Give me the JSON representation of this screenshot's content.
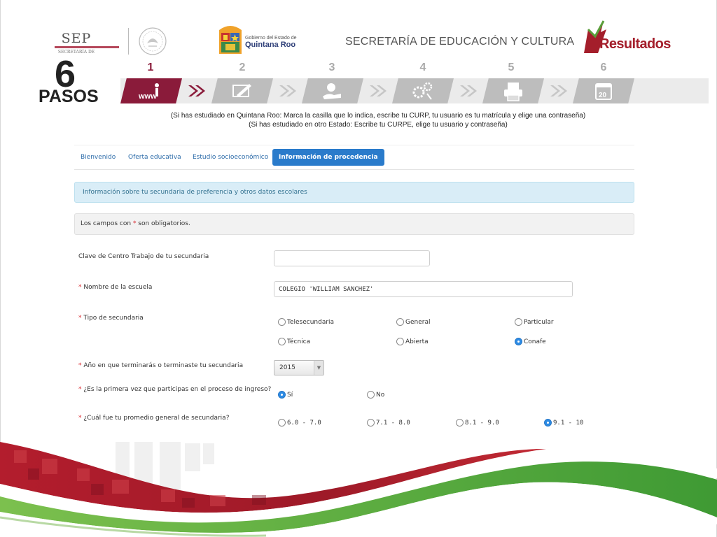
{
  "header": {
    "sep_logo_text": "SEP",
    "sep_logo_sub": "SECRETARÍA DE",
    "qroo_small": "Gobierno del Estado de",
    "qroo_big": "Quintana Roo",
    "title": "SECRETARÍA DE EDUCACIÓN Y CULTURA",
    "results_logo": "Resultados"
  },
  "steps": {
    "big_number": "6",
    "big_word": "PASOS",
    "items": [
      {
        "num": "1",
        "icon": "www-person-icon",
        "active": true
      },
      {
        "num": "2",
        "icon": "form-pencil-icon",
        "active": false
      },
      {
        "num": "3",
        "icon": "money-hand-icon",
        "active": false
      },
      {
        "num": "4",
        "icon": "gears-icon",
        "active": false
      },
      {
        "num": "5",
        "icon": "printer-icon",
        "active": false
      },
      {
        "num": "6",
        "icon": "calendar-icon",
        "active": false
      }
    ],
    "step1_icon_text": "www",
    "step6_icon_text": "20"
  },
  "instructions": {
    "line1": "(Si has estudiado en Quintana Roo: Marca la casilla que lo indica, escribe tu CURP,  tu usuario es tu matrícula y elige una contraseña)",
    "line2": "(Si has estudiado en otro Estado: Escribe tu CURPE, elige tu usuario y contraseña)"
  },
  "tabs": [
    {
      "label": "Bienvenido",
      "active": false
    },
    {
      "label": "Oferta educativa",
      "active": false
    },
    {
      "label": "Estudio socioeconómico",
      "active": false
    },
    {
      "label": "Información de procedencia",
      "active": true
    }
  ],
  "info_message": "Información sobre tu secundaria de preferencia y otros datos escolares",
  "required_note": {
    "before": "Los campos con ",
    "star": "*",
    "after": " son obligatorios."
  },
  "form": {
    "required_mark": "*",
    "clave": {
      "label": "Clave de Centro Trabajo de tu secundaria",
      "value": ""
    },
    "nombre": {
      "label": "Nombre de la escuela",
      "value": "COLEGIO 'WILLIAM SANCHEZ'"
    },
    "tipo": {
      "label": "Tipo de secundaria",
      "options": [
        "Telesecundaria",
        "General",
        "Particular",
        "Técnica",
        "Abierta",
        "Conafe"
      ],
      "selected": "Conafe"
    },
    "anio": {
      "label": "Año en que terminarás o terminaste tu secundaria",
      "value": "2015"
    },
    "primera_vez": {
      "label": "¿Es la primera vez que participas en el proceso de ingreso?",
      "options": [
        "Sí",
        "No"
      ],
      "selected": "Sí"
    },
    "promedio": {
      "label": "¿Cuál fue tu promedio general de secundaria?",
      "options": [
        "6.0 - 7.0",
        "7.1 - 8.0",
        "8.1 - 9.0",
        "9.1 - 10"
      ],
      "selected": "9.1 - 10"
    }
  },
  "colors": {
    "brand_wine": "#8a1b3a",
    "tab_active": "#2a7bcb",
    "info_bg": "#d9edf7",
    "wave_red": "#b8202f",
    "wave_green": "#5aa93a"
  }
}
